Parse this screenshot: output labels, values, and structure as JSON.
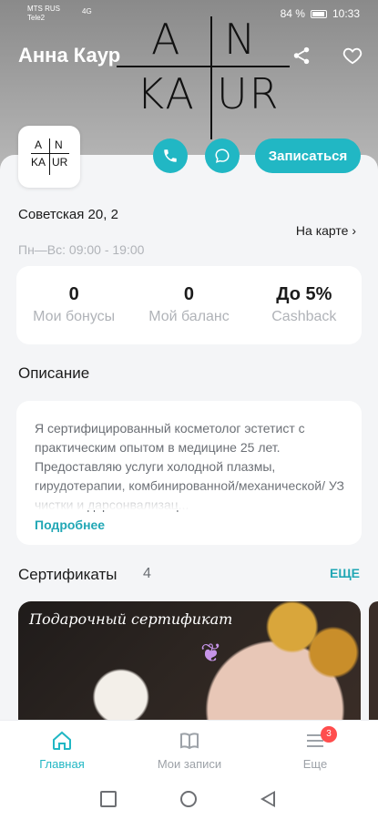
{
  "status_bar": {
    "carrier_1": "MTS RUS",
    "carrier_2": "Tele2",
    "signal_text": "4G",
    "battery_percent": "84 %",
    "time": "10:33"
  },
  "header": {
    "title": "Анна Каур",
    "logo_row1_left": "A",
    "logo_row1_right": "N",
    "logo_row2_left": "KA",
    "logo_row2_right": "UR",
    "share_icon": "share-icon",
    "favorite_icon": "heart-icon"
  },
  "avatar_logo": {
    "row1_left": "A",
    "row1_right": "N",
    "row2_left": "KA",
    "row2_right": "UR"
  },
  "actions": {
    "call_icon": "phone-icon",
    "chat_icon": "chat-icon",
    "book_label": "Записаться"
  },
  "location": {
    "address": "Советская 20, 2",
    "map_link": "На карте ›",
    "hours": "Пн—Вс: 09:00 - 19:00"
  },
  "stats": [
    {
      "value": "0",
      "label": "Мои бонусы"
    },
    {
      "value": "0",
      "label": "Мой баланс"
    },
    {
      "value": "До 5%",
      "label": "Cashback"
    }
  ],
  "description": {
    "heading": "Описание",
    "text": "Я сертифицированный косметолог эстетист с практическим опытом в медицине 25 лет. Предоставляю услуги холодной плазмы, гирудотерапии, комбинированной/механической/ УЗ чистки и дарсонвализац...",
    "more_link": "Подробнее"
  },
  "certificates": {
    "heading": "Сертификаты",
    "count": "4",
    "all_link": "ЕЩЕ",
    "card_title": "Подарочный сертификат"
  },
  "bottom_nav": {
    "items": [
      {
        "label": "Главная",
        "icon": "home-icon",
        "active": true
      },
      {
        "label": "Мои записи",
        "icon": "book-icon",
        "active": false
      },
      {
        "label": "Еще",
        "icon": "menu-icon",
        "active": false,
        "badge": "3"
      }
    ]
  },
  "colors": {
    "accent": "#21b7c4",
    "link": "#21a7b5",
    "badge": "#ff4d4d"
  }
}
